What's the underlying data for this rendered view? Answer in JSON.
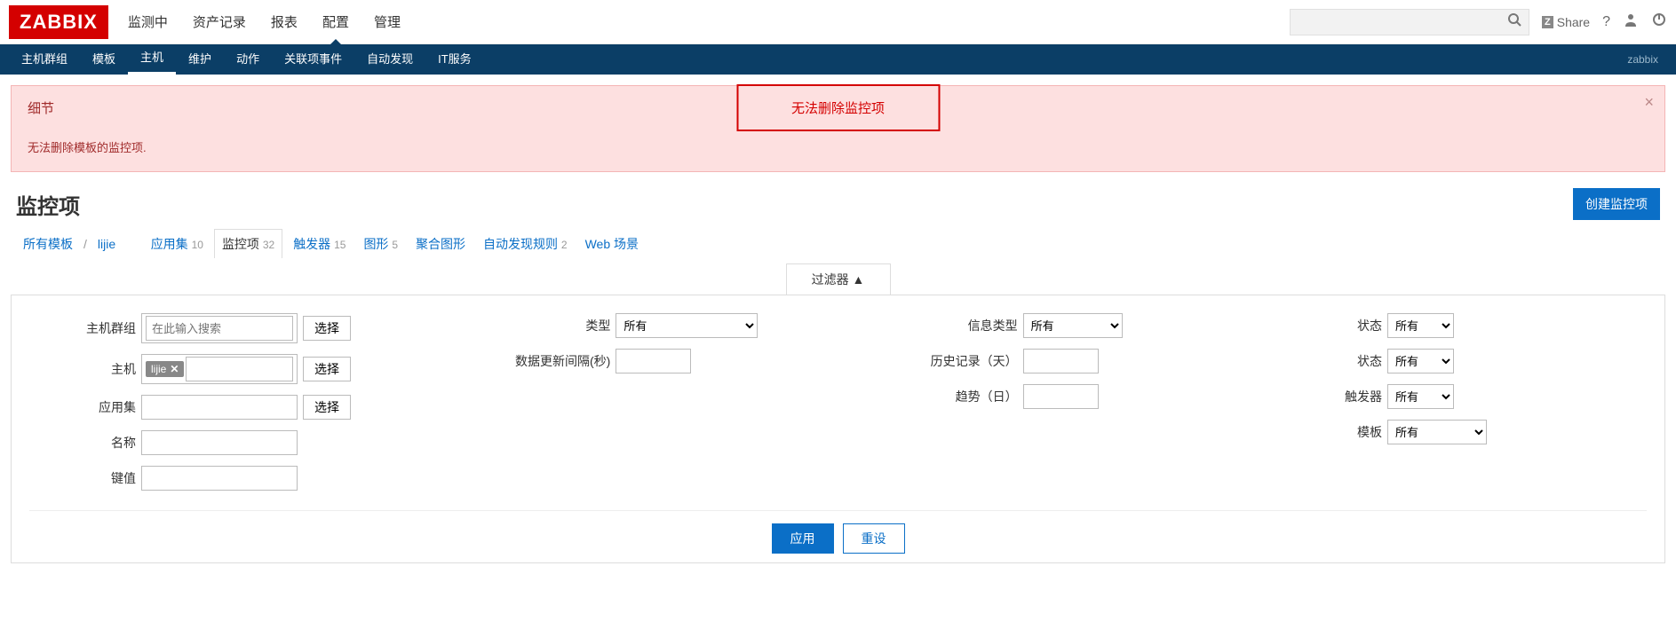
{
  "logo": "ZABBIX",
  "top_nav": {
    "m0": "监测中",
    "m1": "资产记录",
    "m2": "报表",
    "m3": "配置",
    "m4": "管理"
  },
  "top_right": {
    "share": "Share",
    "zabbix": "zabbix"
  },
  "sub_nav": {
    "s0": "主机群组",
    "s1": "模板",
    "s2": "主机",
    "s3": "维护",
    "s4": "动作",
    "s5": "关联项事件",
    "s6": "自动发现",
    "s7": "IT服务"
  },
  "alert": {
    "title": "细节",
    "banner": "无法删除监控项",
    "msg": "无法删除模板的监控项."
  },
  "page": {
    "title": "监控项",
    "create": "创建监控项"
  },
  "bc": {
    "all_tpl": "所有模板",
    "host": "lijie",
    "apps": "应用集",
    "apps_n": "10",
    "items": "监控项",
    "items_n": "32",
    "trig": "触发器",
    "trig_n": "15",
    "graph": "图形",
    "graph_n": "5",
    "screens": "聚合图形",
    "disc": "自动发现规则",
    "disc_n": "2",
    "web": "Web 场景"
  },
  "filter": {
    "tab": "过滤器 ▲",
    "l_hostgroup": "主机群组",
    "ph_hostgroup": "在此输入搜索",
    "btn_select": "选择",
    "l_host": "主机",
    "host_tag": "lijie",
    "l_app": "应用集",
    "l_name": "名称",
    "l_key": "键值",
    "l_type": "类型",
    "v_type": "所有",
    "l_interval": "数据更新间隔(秒)",
    "l_infotype": "信息类型",
    "v_infotype": "所有",
    "l_history": "历史记录（天）",
    "l_trend": "趋势（日）",
    "l_status": "状态",
    "v_status": "所有",
    "l_state": "状态",
    "v_state": "所有",
    "l_trigger": "触发器",
    "v_trigger": "所有",
    "l_template": "模板",
    "v_template": "所有",
    "btn_apply": "应用",
    "btn_reset": "重设"
  }
}
